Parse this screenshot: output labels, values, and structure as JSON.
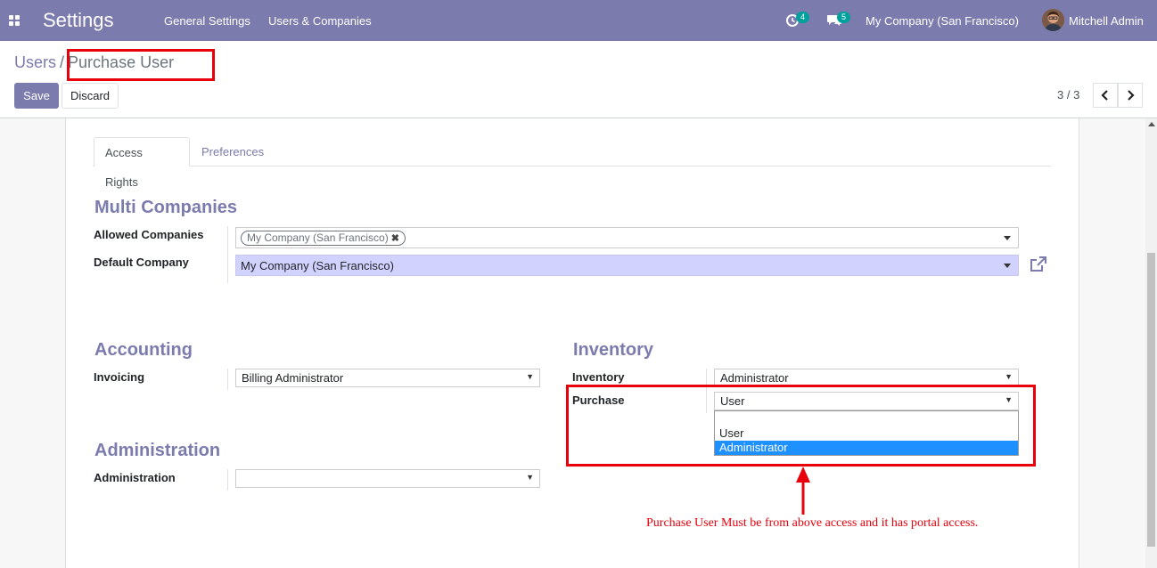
{
  "navbar": {
    "brand": "Settings",
    "menu": [
      "General Settings",
      "Users & Companies"
    ],
    "activity_count": "4",
    "message_count": "5",
    "company": "My Company (San Francisco)",
    "user": "Mitchell Admin",
    "color": "#7c7bad"
  },
  "breadcrumb": {
    "parent": "Users",
    "separator": "/",
    "current": "Purchase User"
  },
  "buttons": {
    "save": "Save",
    "discard": "Discard"
  },
  "pager": {
    "value": "3 / 3"
  },
  "tabs": [
    {
      "label": "Access Rights",
      "active": true
    },
    {
      "label": "Preferences",
      "active": false
    }
  ],
  "multi_companies": {
    "title": "Multi Companies",
    "allowed_label": "Allowed Companies",
    "allowed_tags": [
      "My Company (San Francisco)"
    ],
    "default_label": "Default Company",
    "default_value": "My Company (San Francisco)"
  },
  "accounting": {
    "title": "Accounting",
    "invoicing_label": "Invoicing",
    "invoicing_value": "Billing Administrator"
  },
  "inventory": {
    "title": "Inventory",
    "inventory_label": "Inventory",
    "inventory_value": "Administrator",
    "purchase_label": "Purchase",
    "purchase_value": "User",
    "purchase_options": [
      "",
      "User",
      "Administrator"
    ],
    "purchase_highlighted": "Administrator"
  },
  "administration": {
    "title": "Administration",
    "administration_label": "Administration",
    "administration_value": ""
  },
  "annotation": {
    "text": "Purchase User Must be from above access and it has portal access.",
    "color": "#e8000b"
  },
  "icons": {
    "apps": "apps-grid-icon",
    "activity": "activity-clock-icon",
    "messages": "chat-bubbles-icon",
    "external": "external-link-icon"
  }
}
